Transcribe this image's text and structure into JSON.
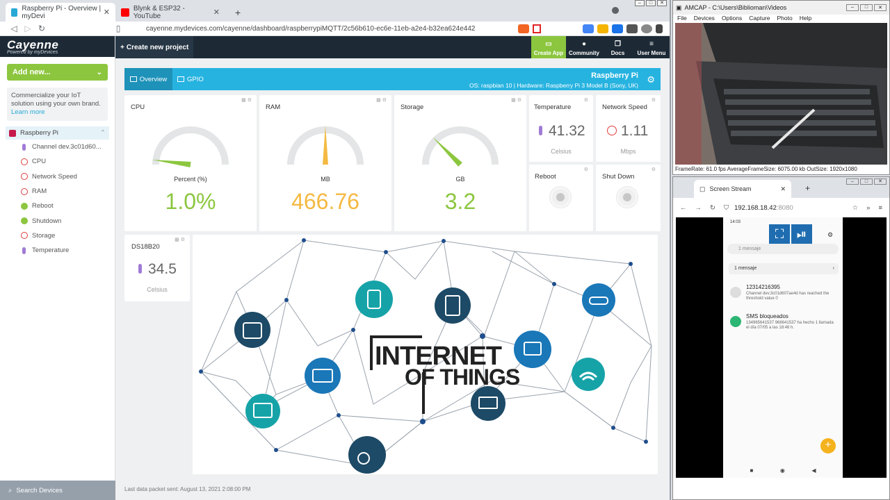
{
  "browser": {
    "tabs": [
      {
        "title": "Raspberry Pi - Overview | myDevi"
      },
      {
        "title": "Blynk & ESP32 - YouTube"
      }
    ],
    "new_tab": "+",
    "url": "cayenne.mydevices.com/cayenne/dashboard/raspberrypiMQTT/2c56b610-ec6e-11eb-a2e4-b32ea624e442"
  },
  "cayenne": {
    "brand": "Cayenne",
    "brand_sub": "Powered by myDevices",
    "add_new": "Add new...",
    "promo_text": "Commercialize your IoT solution using your own brand.",
    "promo_link": "Learn more",
    "create_project": "Create new project",
    "nav": [
      {
        "label": "Create App",
        "icon": "phone-icon"
      },
      {
        "label": "Community",
        "icon": "chat-icon"
      },
      {
        "label": "Docs",
        "icon": "docs-icon"
      },
      {
        "label": "User Menu",
        "icon": "menu-icon"
      }
    ],
    "device_root": "Raspberry Pi",
    "devices": [
      {
        "label": "Channel dev.3c01d60...",
        "icon": "thermometer-icon"
      },
      {
        "label": "CPU",
        "icon": "gauge-icon"
      },
      {
        "label": "Network Speed",
        "icon": "gauge-icon"
      },
      {
        "label": "RAM",
        "icon": "gauge-icon"
      },
      {
        "label": "Reboot",
        "icon": "button-icon"
      },
      {
        "label": "Shutdown",
        "icon": "button-icon"
      },
      {
        "label": "Storage",
        "icon": "gauge-icon"
      },
      {
        "label": "Temperature",
        "icon": "thermometer-icon"
      }
    ],
    "search_devices": "Search Devices",
    "overview_tab": "Overview",
    "gpio_tab": "GPIO",
    "device_name": "Raspberry Pi",
    "device_details": "OS: raspbian 10   |   Hardware: Raspberry Pi 3 Model B (Sony, UK)",
    "widgets": {
      "cpu": {
        "title": "CPU",
        "unit": "Percent (%)",
        "value": "1.0%",
        "level": 0.01,
        "color": "#8cc63f"
      },
      "ram": {
        "title": "RAM",
        "unit": "MB",
        "value": "466.76",
        "level": 0.5,
        "color": "#f4b942"
      },
      "storage": {
        "title": "Storage",
        "unit": "GB",
        "value": "3.2",
        "level": 0.25,
        "color": "#8cc63f"
      },
      "temperature": {
        "title": "Temperature",
        "value": "41.32",
        "unit": "Celsius"
      },
      "network": {
        "title": "Network Speed",
        "value": "1.11",
        "unit": "Mbps"
      },
      "reboot": {
        "title": "Reboot"
      },
      "shutdown": {
        "title": "Shut Down"
      },
      "ds18b20": {
        "title": "DS18B20",
        "value": "34.5",
        "unit": "Celsius"
      }
    },
    "iot_line1": "INTERNET",
    "iot_line2": "OF THINGS",
    "last_packet": "Last data packet sent: August 13, 2021 2:08:00 PM"
  },
  "amcap": {
    "title": "AMCAP - C:\\Users\\Biblioman\\Videos",
    "menu": [
      "File",
      "Devices",
      "Options",
      "Capture",
      "Photo",
      "Help"
    ],
    "status": "FrameRate: 61.0 fps     AverageFrameSize: 6075.00 kb    OutSize: 1920x1080"
  },
  "stream": {
    "tab_title": "Screen Stream",
    "address": "192.168.18.42",
    "port": ":8080",
    "phone": {
      "time": "14:03",
      "search_placeholder": "1 mensaje",
      "row": "1 mensaje",
      "msg1_title": "12314216395",
      "msg1_body": "Channel dev.3c01d607ae4d has reached the threshold value 0",
      "msg2_title": "SMS bloqueados",
      "msg2_body": "134965641537 968641537 ha hecho 1 llamada el día 07/05 a las 18:48 h."
    }
  }
}
